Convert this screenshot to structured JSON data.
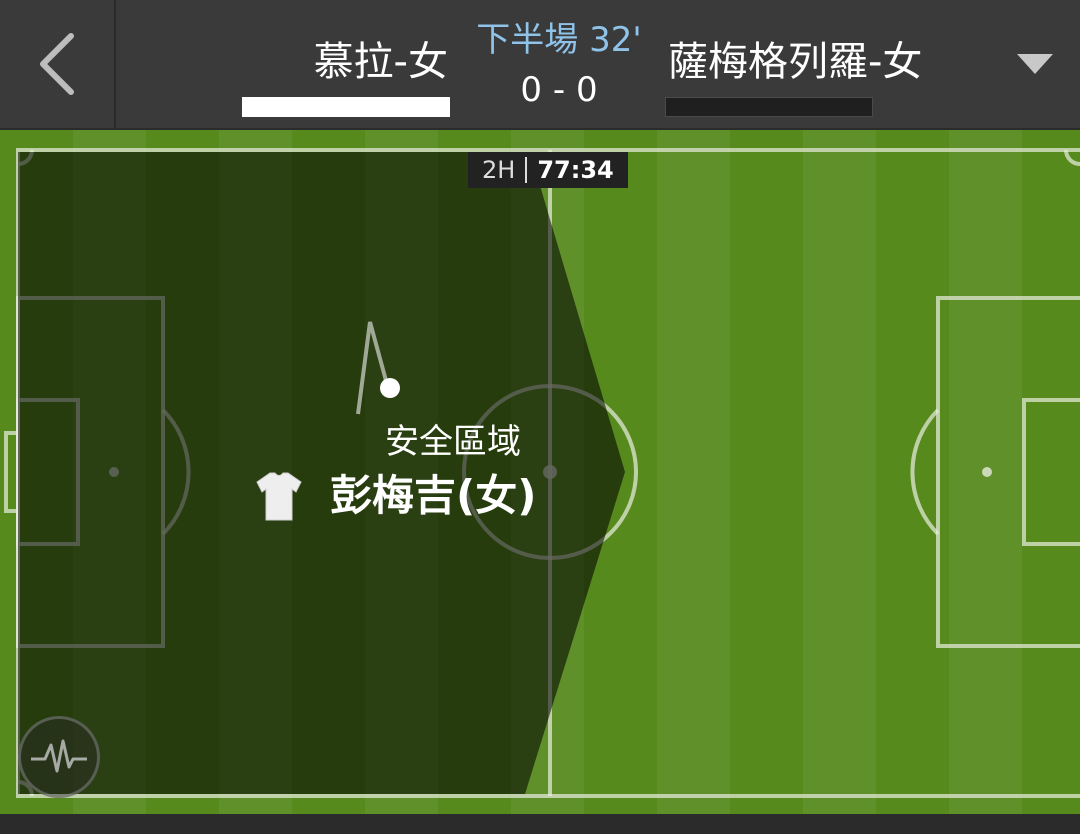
{
  "header": {
    "home_team": "慕拉-女",
    "away_team": "薩梅格列羅-女",
    "period_label": "下半場 32'",
    "score": "0 - 0",
    "back_icon": "chevron-left-icon",
    "dropdown_icon": "triangle-down-icon"
  },
  "pitch": {
    "clock_period": "2H",
    "clock_time": "77:34",
    "zone_label": "安全區域",
    "player_name": "彭梅吉(女)",
    "jersey_icon": "jersey-icon",
    "pulse_icon": "pulse-icon"
  },
  "colors": {
    "home_team": "#ffffff",
    "away_team": "#1f1f1f",
    "period_label": "#8fc3e9",
    "pitch_grass": "#5b8d1f"
  }
}
